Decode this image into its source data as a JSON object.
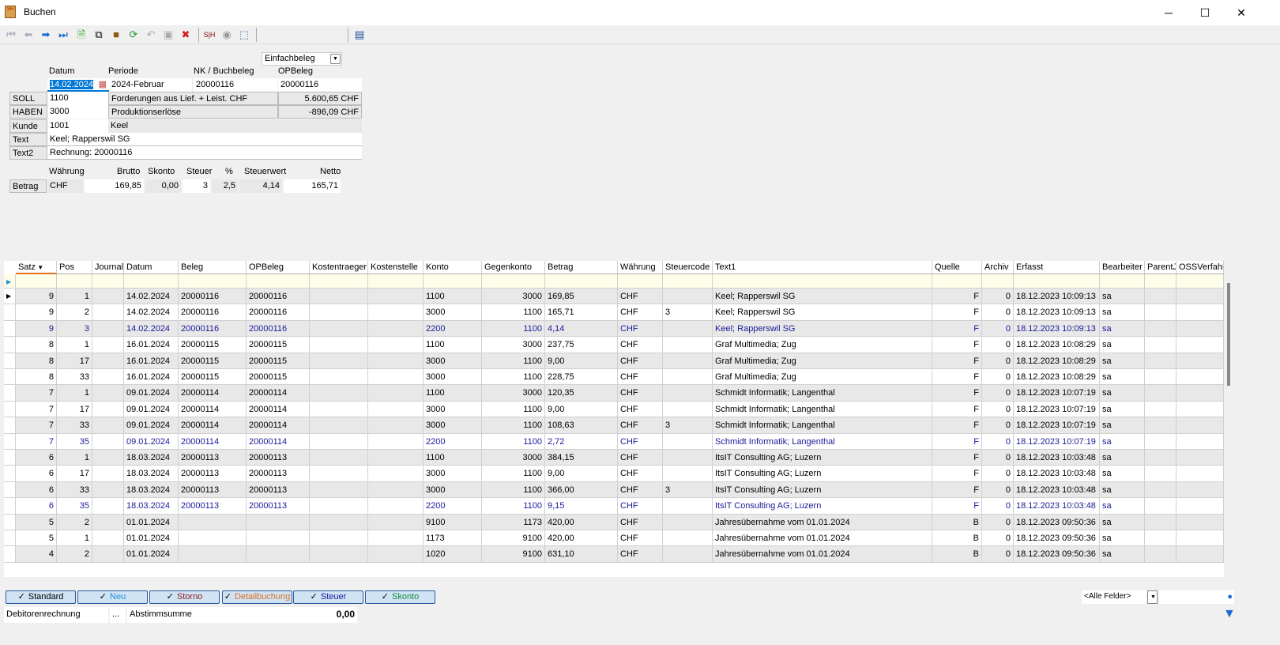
{
  "window": {
    "title": "Buchen",
    "minimize": "─",
    "maximize": "☐",
    "close": "✕"
  },
  "toolbar": {
    "mode": "Einfachbeleg"
  },
  "form": {
    "headers": {
      "datum": "Datum",
      "periode": "Periode",
      "nk": "NK / Buchbeleg",
      "opbeleg": "OPBeleg"
    },
    "datum": "14.02.2024",
    "periode": "2024-Februar",
    "nk": "20000116",
    "opbeleg": "20000116",
    "soll": {
      "label": "SOLL",
      "konto": "1100",
      "name": "Forderungen aus Lief. + Leist. CHF",
      "saldo": "5.600,65 CHF"
    },
    "haben": {
      "label": "HABEN",
      "konto": "3000",
      "name": "Produktionserlöse",
      "saldo": "-896,09 CHF"
    },
    "kunde": {
      "label": "Kunde",
      "nr": "1001",
      "name": "Keel"
    },
    "text": {
      "label": "Text",
      "value": "Keel; Rapperswil SG"
    },
    "text2": {
      "label": "Text2",
      "value": "Rechnung: 20000116"
    },
    "betrag_headers": {
      "waehrung": "Währung",
      "brutto": "Brutto",
      "skonto": "Skonto",
      "steuer": "Steuer",
      "pct": "%",
      "steuerwert": "Steuerwert",
      "netto": "Netto"
    },
    "betrag": {
      "label": "Betrag",
      "waehrung": "CHF",
      "brutto": "169,85",
      "skonto": "0,00",
      "steuer": "3",
      "pct": "2,5",
      "steuerwert": "4,14",
      "netto": "165,71"
    }
  },
  "grid": {
    "columns": [
      "Satz",
      "Pos",
      "Journal",
      "Datum",
      "Beleg",
      "OPBeleg",
      "Kostentraeger",
      "Kostenstelle",
      "Konto",
      "Gegenkonto",
      "Betrag",
      "Währung",
      "Steuercode",
      "Text1",
      "Quelle",
      "Archiv",
      "Erfasst",
      "Bearbeiter",
      "ParentJournal",
      "OSSVerfahren"
    ],
    "rows": [
      [
        "9",
        "1",
        "",
        "14.02.2024",
        "20000116",
        "20000116",
        "",
        "",
        "1100",
        "3000",
        "169,85",
        "CHF",
        "",
        "Keel; Rapperswil SG",
        "F",
        "0",
        "18.12.2023 10:09:13",
        "sa",
        "",
        ""
      ],
      [
        "9",
        "2",
        "",
        "14.02.2024",
        "20000116",
        "20000116",
        "",
        "",
        "3000",
        "1100",
        "165,71",
        "CHF",
        "3",
        "Keel; Rapperswil SG",
        "F",
        "0",
        "18.12.2023 10:09:13",
        "sa",
        "",
        ""
      ],
      [
        "9",
        "3",
        "",
        "14.02.2024",
        "20000116",
        "20000116",
        "",
        "",
        "2200",
        "1100",
        "4,14",
        "CHF",
        "",
        "Keel; Rapperswil SG",
        "F",
        "0",
        "18.12.2023 10:09:13",
        "sa",
        "",
        ""
      ],
      [
        "8",
        "1",
        "",
        "16.01.2024",
        "20000115",
        "20000115",
        "",
        "",
        "1100",
        "3000",
        "237,75",
        "CHF",
        "",
        "Graf Multimedia; Zug",
        "F",
        "0",
        "18.12.2023 10:08:29",
        "sa",
        "",
        ""
      ],
      [
        "8",
        "17",
        "",
        "16.01.2024",
        "20000115",
        "20000115",
        "",
        "",
        "3000",
        "1100",
        "9,00",
        "CHF",
        "",
        "Graf Multimedia; Zug",
        "F",
        "0",
        "18.12.2023 10:08:29",
        "sa",
        "",
        ""
      ],
      [
        "8",
        "33",
        "",
        "16.01.2024",
        "20000115",
        "20000115",
        "",
        "",
        "3000",
        "1100",
        "228,75",
        "CHF",
        "",
        "Graf Multimedia; Zug",
        "F",
        "0",
        "18.12.2023 10:08:29",
        "sa",
        "",
        ""
      ],
      [
        "7",
        "1",
        "",
        "09.01.2024",
        "20000114",
        "20000114",
        "",
        "",
        "1100",
        "3000",
        "120,35",
        "CHF",
        "",
        "Schmidt Informatik; Langenthal",
        "F",
        "0",
        "18.12.2023 10:07:19",
        "sa",
        "",
        ""
      ],
      [
        "7",
        "17",
        "",
        "09.01.2024",
        "20000114",
        "20000114",
        "",
        "",
        "3000",
        "1100",
        "9,00",
        "CHF",
        "",
        "Schmidt Informatik; Langenthal",
        "F",
        "0",
        "18.12.2023 10:07:19",
        "sa",
        "",
        ""
      ],
      [
        "7",
        "33",
        "",
        "09.01.2024",
        "20000114",
        "20000114",
        "",
        "",
        "3000",
        "1100",
        "108,63",
        "CHF",
        "3",
        "Schmidt Informatik; Langenthal",
        "F",
        "0",
        "18.12.2023 10:07:19",
        "sa",
        "",
        ""
      ],
      [
        "7",
        "35",
        "",
        "09.01.2024",
        "20000114",
        "20000114",
        "",
        "",
        "2200",
        "1100",
        "2,72",
        "CHF",
        "",
        "Schmidt Informatik; Langenthal",
        "F",
        "0",
        "18.12.2023 10:07:19",
        "sa",
        "",
        ""
      ],
      [
        "6",
        "1",
        "",
        "18.03.2024",
        "20000113",
        "20000113",
        "",
        "",
        "1100",
        "3000",
        "384,15",
        "CHF",
        "",
        "ItsIT Consulting AG; Luzern",
        "F",
        "0",
        "18.12.2023 10:03:48",
        "sa",
        "",
        ""
      ],
      [
        "6",
        "17",
        "",
        "18.03.2024",
        "20000113",
        "20000113",
        "",
        "",
        "3000",
        "1100",
        "9,00",
        "CHF",
        "",
        "ItsIT Consulting AG; Luzern",
        "F",
        "0",
        "18.12.2023 10:03:48",
        "sa",
        "",
        ""
      ],
      [
        "6",
        "33",
        "",
        "18.03.2024",
        "20000113",
        "20000113",
        "",
        "",
        "3000",
        "1100",
        "366,00",
        "CHF",
        "3",
        "ItsIT Consulting AG; Luzern",
        "F",
        "0",
        "18.12.2023 10:03:48",
        "sa",
        "",
        ""
      ],
      [
        "6",
        "35",
        "",
        "18.03.2024",
        "20000113",
        "20000113",
        "",
        "",
        "2200",
        "1100",
        "9,15",
        "CHF",
        "",
        "ItsIT Consulting AG; Luzern",
        "F",
        "0",
        "18.12.2023 10:03:48",
        "sa",
        "",
        ""
      ],
      [
        "5",
        "2",
        "",
        "01.01.2024",
        "",
        "",
        "",
        "",
        "9100",
        "1173",
        "420,00",
        "CHF",
        "",
        "Jahresübernahme vom 01.01.2024",
        "B",
        "0",
        "18.12.2023 09:50:36",
        "sa",
        "",
        ""
      ],
      [
        "5",
        "1",
        "",
        "01.01.2024",
        "",
        "",
        "",
        "",
        "1173",
        "9100",
        "420,00",
        "CHF",
        "",
        "Jahresübernahme vom 01.01.2024",
        "B",
        "0",
        "18.12.2023 09:50:36",
        "sa",
        "",
        ""
      ],
      [
        "4",
        "2",
        "",
        "01.01.2024",
        "",
        "",
        "",
        "",
        "1020",
        "9100",
        "631,10",
        "CHF",
        "",
        "Jahresübernahme vom 01.01.2024",
        "B",
        "0",
        "18.12.2023 09:50:36",
        "sa",
        "",
        ""
      ]
    ],
    "highlight_rows": [
      2,
      9,
      13
    ]
  },
  "filters": [
    {
      "label": "Standard",
      "color": "#000000"
    },
    {
      "label": "Neu",
      "color": "#1e90d0"
    },
    {
      "label": "Storno",
      "color": "#8b1a1a"
    },
    {
      "label": "Detailbuchung",
      "color": "#e07020"
    },
    {
      "label": "Steuer",
      "color": "#1a1a9a"
    },
    {
      "label": "Skonto",
      "color": "#1a8a3a"
    }
  ],
  "check": "✓",
  "search": {
    "field": "<Alle Felder>"
  },
  "status": {
    "type": "Debitorenrechnung",
    "dots": "...",
    "sum_label": "Abstimmsumme",
    "sum_value": "0,00"
  }
}
